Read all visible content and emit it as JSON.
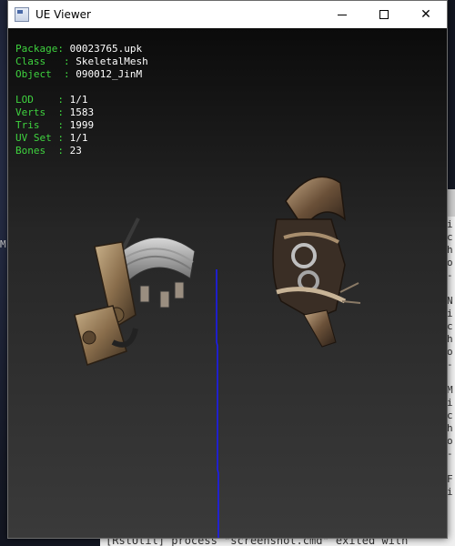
{
  "window": {
    "title": "UE Viewer"
  },
  "info": {
    "package_label": "Package: ",
    "package": "00023765.upk",
    "class_label": "Class   : ",
    "class": "SkeletalMesh",
    "object_label": "Object  : ",
    "object": "090012_JinM",
    "lod_label": "LOD    : ",
    "lod": "1/1",
    "verts_label": "Verts  : ",
    "verts": "1583",
    "tris_label": "Tris   : ",
    "tris": "1999",
    "uvset_label": "UV Set : ",
    "uvset": "1/1",
    "bones_label": "Bones  : ",
    "bones": "23"
  },
  "console": {
    "right_lines": "i\nc\nh\no\n-\n\nN\ni\nc\nh\no\n-\n\nM\ni\nc\nh\no\n-\n\nF\ni",
    "bottom_line": "[RstUtil] process \"screenshot.cmd\" exited with",
    "edge_letter": "M"
  },
  "colors": {
    "label_green": "#3fd33f",
    "axis_blue": "#1a1aff"
  }
}
